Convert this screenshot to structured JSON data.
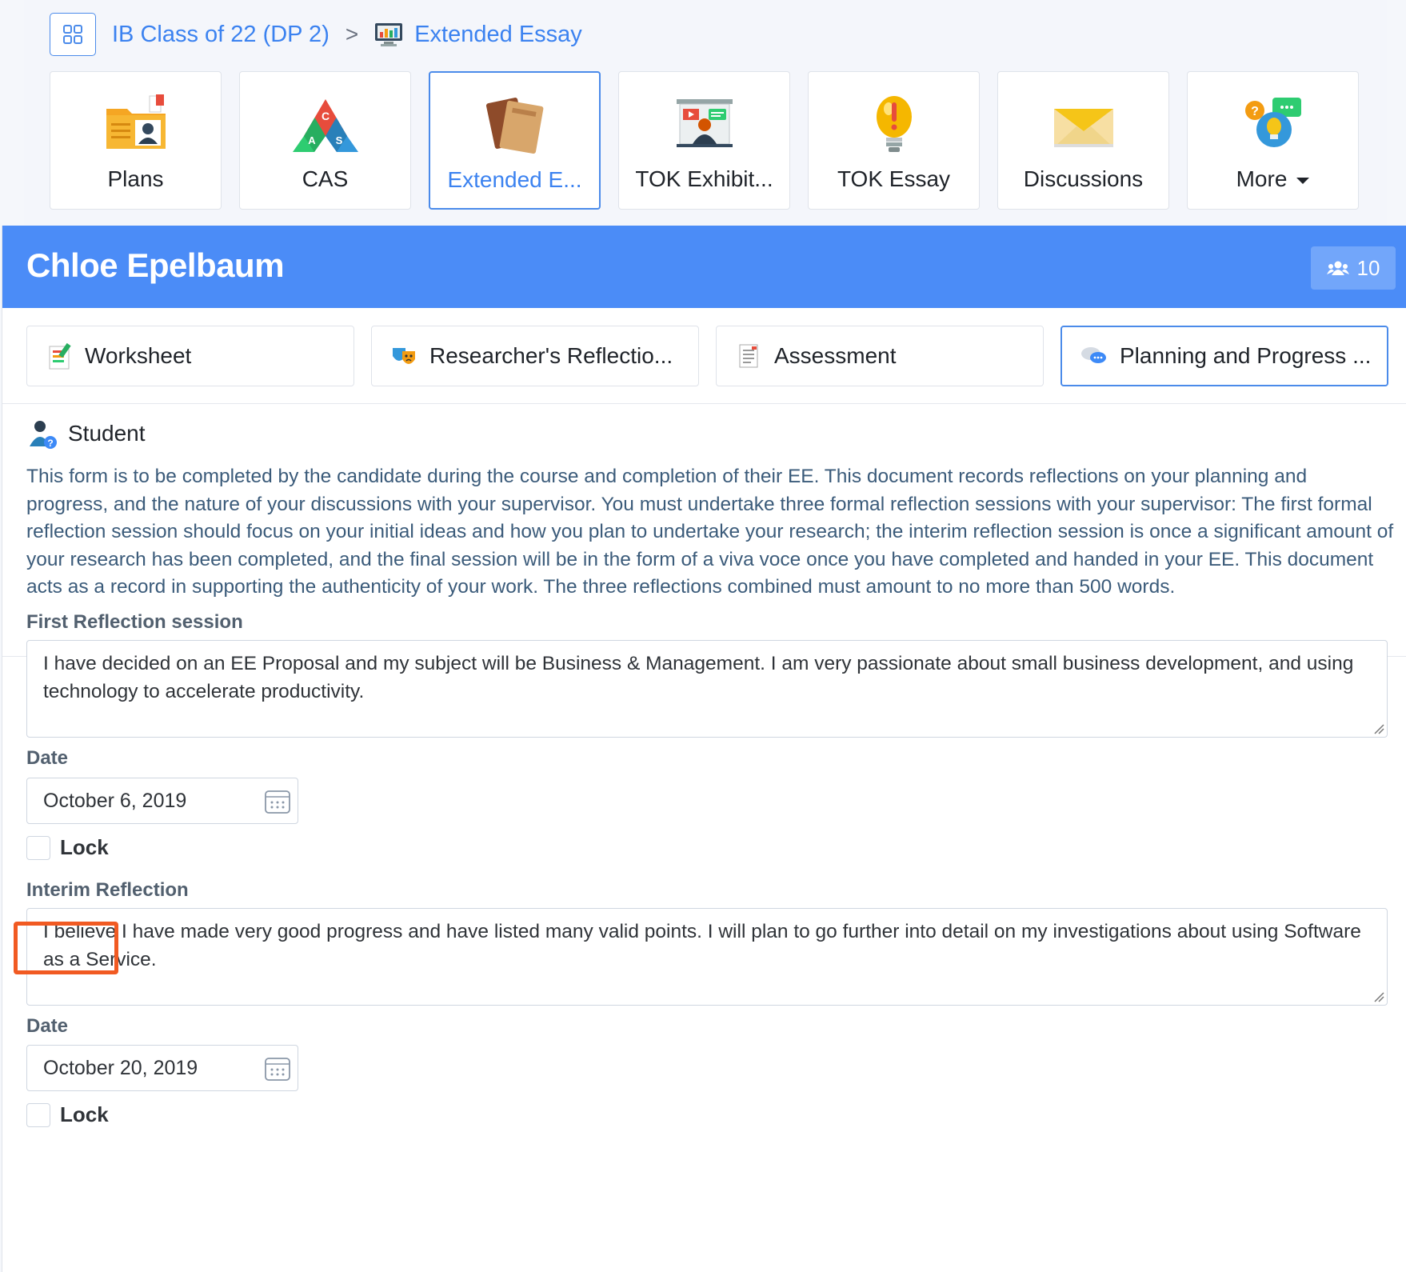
{
  "breadcrumb": {
    "home_icon": "grid-icon",
    "class_name": "IB Class of 22 (DP 2)",
    "separator": ">",
    "current": "Extended Essay"
  },
  "tiles": [
    {
      "label": "Plans",
      "icon": "folder-user-icon"
    },
    {
      "label": "CAS",
      "icon": "cas-triangle-icon"
    },
    {
      "label": "Extended E...",
      "icon": "books-icon",
      "active": true
    },
    {
      "label": "TOK Exhibit...",
      "icon": "presentation-icon"
    },
    {
      "label": "TOK Essay",
      "icon": "lightbulb-icon"
    },
    {
      "label": "Discussions",
      "icon": "envelope-icon"
    },
    {
      "label": "More",
      "icon": "chat-idea-icon"
    }
  ],
  "student_header": {
    "name": "Chloe Epelbaum",
    "member_count": "10"
  },
  "subtabs": [
    {
      "label": "Worksheet",
      "icon": "worksheet-icon"
    },
    {
      "label": "Researcher's Reflectio...",
      "icon": "masks-icon"
    },
    {
      "label": "Assessment",
      "icon": "checklist-icon"
    },
    {
      "label": "Planning and Progress ...",
      "icon": "chat-bubbles-icon",
      "active": true
    }
  ],
  "section": {
    "title": "Student",
    "description": "This form is to be completed by the candidate during the course and completion of their EE. This document records reflections on your planning and progress, and the nature of your discussions with your supervisor. You must undertake three formal reflection sessions with your supervisor: The first formal reflection session should focus on your initial ideas and how you plan to undertake your research; the interim reflection session is once a significant amount of your research has been completed, and the final session will be in the form of a viva voce once you have completed and handed in your EE. This document acts as a record in supporting the authenticity of your work. The three reflections combined must amount to no more than 500 words."
  },
  "form": {
    "first": {
      "label": "First Reflection session",
      "text": "I have decided on an EE Proposal and my subject will be Business & Management. I am very passionate about small business development, and using technology to accelerate productivity.",
      "date_label": "Date",
      "date": "October 6, 2019",
      "lock_label": "Lock",
      "locked": false
    },
    "interim": {
      "label": "Interim Reflection",
      "text": "I believe I have made very good progress and have listed many valid points. I will plan to go further into detail on my investigations about using Software as a Service.",
      "date_label": "Date",
      "date": "October 20, 2019",
      "lock_label": "Lock",
      "locked": false
    }
  },
  "colors": {
    "accent": "#4b8cf7",
    "link": "#3b82f0",
    "highlight": "#f15a22"
  }
}
